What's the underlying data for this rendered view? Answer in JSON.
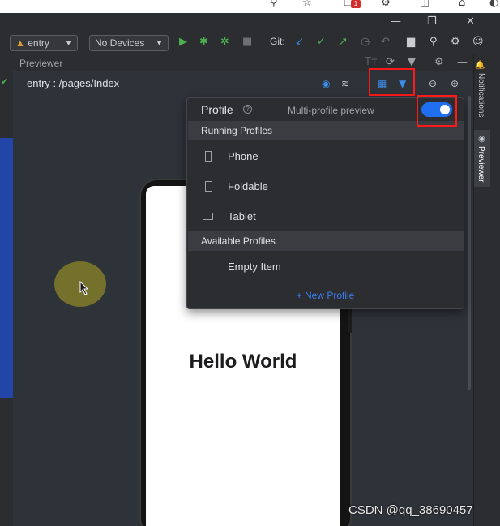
{
  "toolbar": {
    "module": "entry",
    "device": "No Devices",
    "git_label": "Git:"
  },
  "previewer": {
    "title": "Previewer",
    "path": "entry : /pages/Index"
  },
  "phone": {
    "text": "Hello World"
  },
  "profile_popup": {
    "title": "Profile",
    "help": "?",
    "multi_profile_label": "Multi-profile preview",
    "multi_profile_enabled": true,
    "running_header": "Running Profiles",
    "running": [
      {
        "label": "Phone",
        "icon": "phone-icon"
      },
      {
        "label": "Foldable",
        "icon": "foldable-icon"
      },
      {
        "label": "Tablet",
        "icon": "tablet-icon"
      }
    ],
    "available_header": "Available Profiles",
    "available": [
      {
        "label": "Empty Item"
      }
    ],
    "new_profile": "+ New Profile"
  },
  "side_tabs": {
    "notifications": "Notifications",
    "previewer": "Previewer"
  },
  "browser": {
    "badge": "1"
  },
  "watermark": "CSDN @qq_38690457",
  "colors": {
    "accent_blue": "#1f6ff0",
    "highlight_red": "#ff1a1a",
    "run_green": "#4caf50"
  }
}
